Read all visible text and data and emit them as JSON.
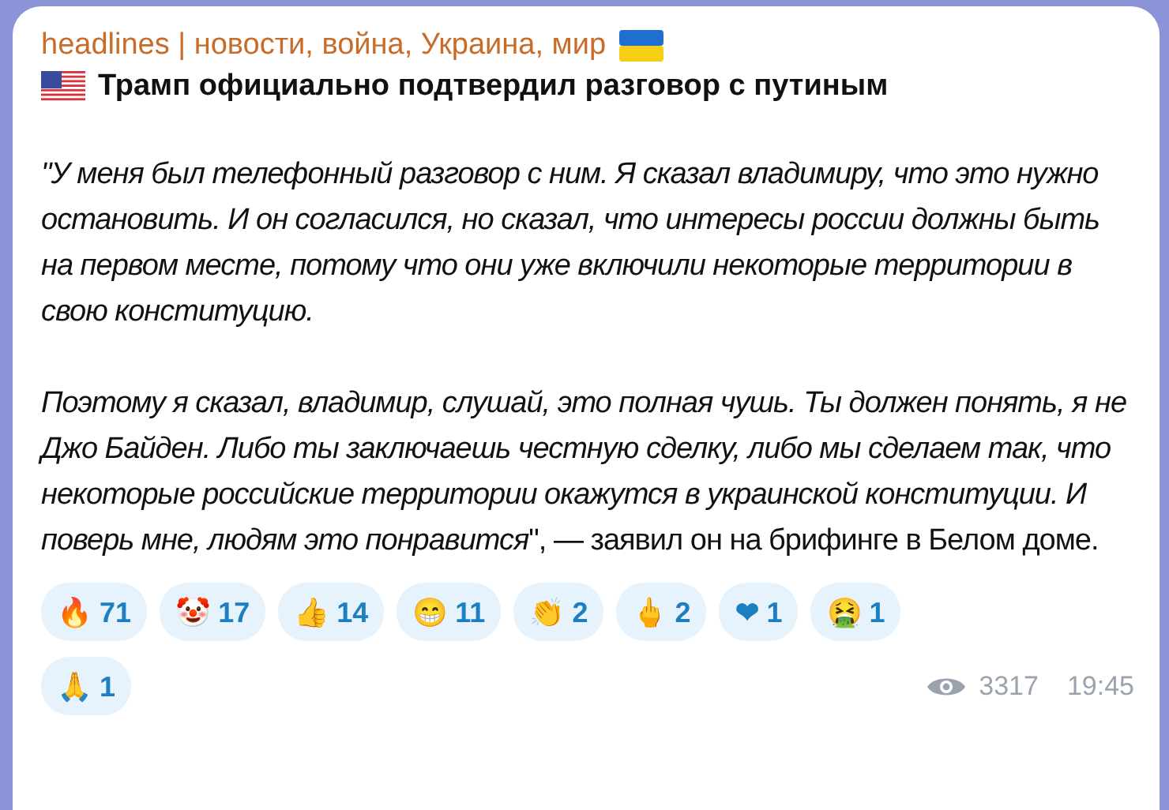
{
  "message": {
    "channel": "headlines | новости, война, Украина, мир",
    "title": "Трамп официально подтвердил разговор с путиным",
    "paragraphs": [
      {
        "kind": "italic",
        "text": "\"У меня был телефонный разговор с ним. Я сказал владимиру, что это нужно остановить. И он согласился, но сказал, что интересы россии должны быть на первом месте, потому что они уже включили некоторые территории в свою конституцию."
      },
      {
        "kind": "mixed",
        "text": "*Поэтому я сказал, владимир, слушай, это полная чушь. Ты должен понять, я не Джо Байден. Либо ты заключаешь честную сделку, либо мы сделаем так, что некоторые российские территории окажутся в украинской конституции. И поверь мне, людям это понравится*\", — заявил он на брифинге в Белом доме."
      }
    ],
    "reactions": [
      {
        "emoji": "🔥",
        "count": "71"
      },
      {
        "emoji": "🤡",
        "count": "17"
      },
      {
        "emoji": "👍",
        "count": "14"
      },
      {
        "emoji": "😁",
        "count": "11"
      },
      {
        "emoji": "👏",
        "count": "2"
      },
      {
        "emoji": "🖕",
        "count": "2"
      },
      {
        "emoji": "❤",
        "count": "1"
      },
      {
        "emoji": "🤮",
        "count": "1"
      },
      {
        "emoji": "🙏",
        "count": "1"
      }
    ],
    "views": "3317",
    "time": "19:45"
  }
}
